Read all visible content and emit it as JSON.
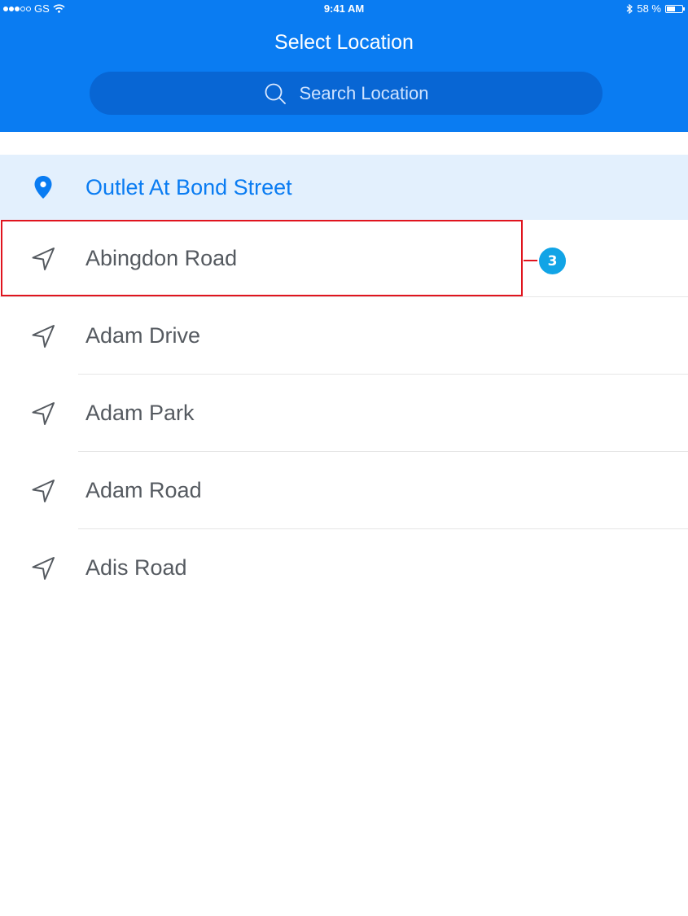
{
  "status_bar": {
    "carrier": "GS",
    "time": "9:41 AM",
    "battery": "58 %",
    "battery_level": 0.58
  },
  "header": {
    "title": "Select Location"
  },
  "search": {
    "placeholder": "Search Location",
    "icon": "search-icon"
  },
  "current_location": {
    "label": "Outlet At Bond Street",
    "icon": "location-pin-icon"
  },
  "locations": [
    {
      "label": "Abingdon Road",
      "icon": "navigation-arrow-icon"
    },
    {
      "label": "Adam Drive",
      "icon": "navigation-arrow-icon"
    },
    {
      "label": "Adam Park",
      "icon": "navigation-arrow-icon"
    },
    {
      "label": "Adam Road",
      "icon": "navigation-arrow-icon"
    },
    {
      "label": "Adis Road",
      "icon": "navigation-arrow-icon"
    }
  ],
  "annotation": {
    "badge": "3"
  },
  "colors": {
    "header": "#0a7cf2",
    "search_bar": "#0866d4",
    "current_row_bg": "#e3f0fd",
    "highlight_border": "#e0141e",
    "badge": "#11a4e6"
  }
}
